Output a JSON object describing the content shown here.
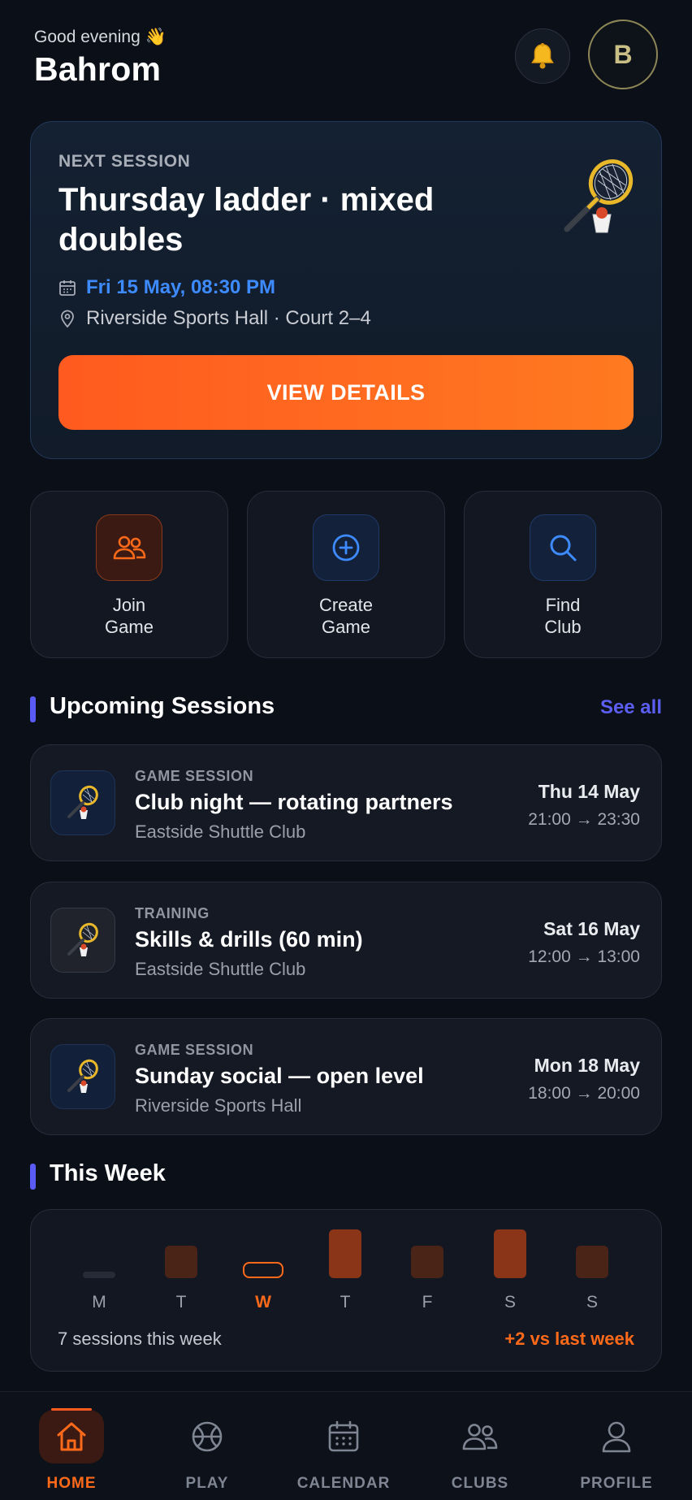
{
  "header": {
    "greeting": "Good evening 👋",
    "username": "Bahrom",
    "avatar_initial": "B"
  },
  "next_session": {
    "label": "NEXT SESSION",
    "title": "Thursday ladder · mixed doubles",
    "date": "Fri 15 May, 08:30 PM",
    "location": "Riverside Sports Hall · Court 2–4",
    "button_label": "VIEW DETAILS"
  },
  "quick_actions": [
    {
      "label": "Join Game",
      "icon": "people-icon"
    },
    {
      "label": "Create Game",
      "icon": "plus-circle-icon"
    },
    {
      "label": "Find Club",
      "icon": "search-icon"
    }
  ],
  "upcoming": {
    "title": "Upcoming Sessions",
    "see_all": "See all",
    "items": [
      {
        "type": "GAME SESSION",
        "title": "Club night — rotating partners",
        "club": "Eastside Shuttle Club",
        "day": "Thu 14 May",
        "time": "21:00 → 23:30"
      },
      {
        "type": "TRAINING",
        "title": "Skills & drills (60 min)",
        "club": "Eastside Shuttle Club",
        "day": "Sat 16 May",
        "time": "12:00 → 13:00"
      },
      {
        "type": "GAME SESSION",
        "title": "Sunday social — open level",
        "club": "Riverside Sports Hall",
        "day": "Mon 18 May",
        "time": "18:00 → 20:00"
      }
    ]
  },
  "this_week": {
    "title": "This Week",
    "days": [
      "M",
      "T",
      "W",
      "T",
      "F",
      "S",
      "S"
    ],
    "today_index": 2,
    "levels": [
      0.1,
      1,
      0,
      2,
      1,
      2,
      1
    ],
    "sessions_text": "7 sessions this week",
    "delta_text": "+2 vs last week"
  },
  "tabbar": {
    "tabs": [
      {
        "label": "HOME",
        "icon": "home-icon",
        "active": true
      },
      {
        "label": "PLAY",
        "icon": "ball-icon",
        "active": false
      },
      {
        "label": "CALENDAR",
        "icon": "calendar-icon",
        "active": false
      },
      {
        "label": "CLUBS",
        "icon": "clubs-icon",
        "active": false
      },
      {
        "label": "PROFILE",
        "icon": "profile-icon",
        "active": false
      }
    ]
  },
  "colors": {
    "accent_orange": "#ff6a1a",
    "accent_blue": "#3d8bff",
    "accent_purple": "#5a5af5",
    "background": "#0b0f17"
  }
}
